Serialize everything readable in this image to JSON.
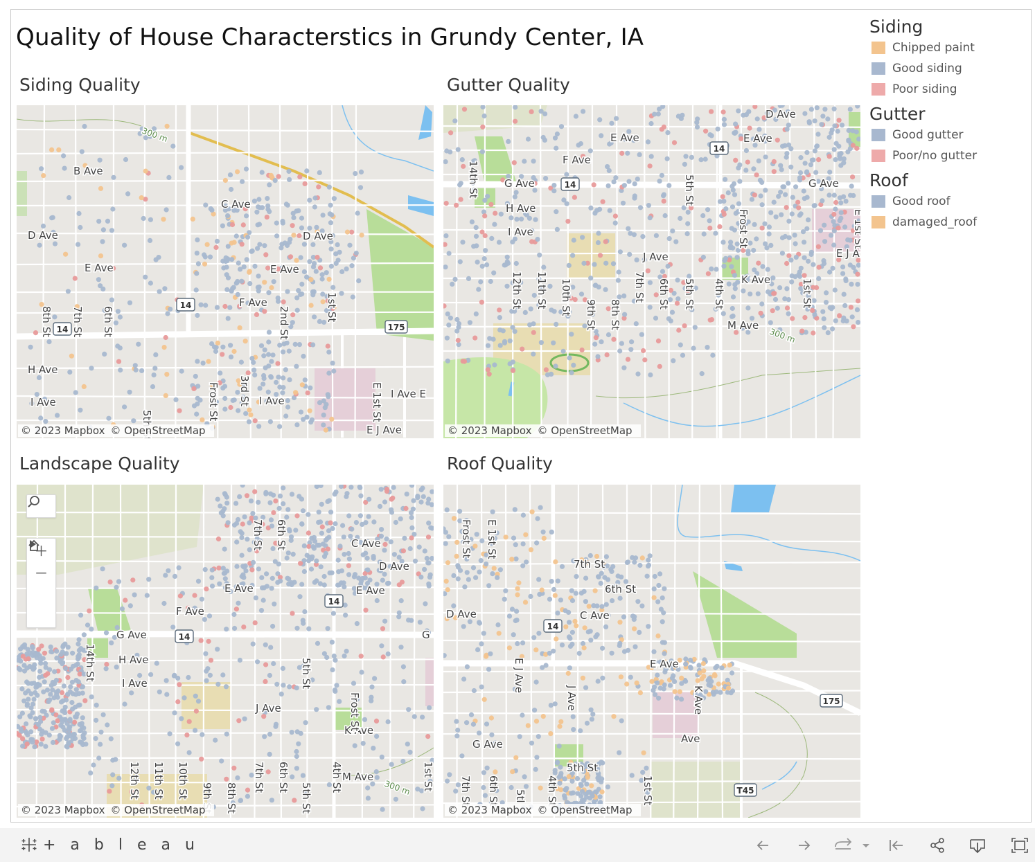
{
  "dashboard": {
    "title": "Quality of House Characterstics in Grundy Center, IA"
  },
  "panels": [
    {
      "title": "Siding Quality",
      "palette": [
        "#a8b8cf",
        "#a8b8cf",
        "#a8b8cf",
        "#a8b8cf",
        "#a8b8cf",
        "#a8b8cf",
        "#e89a9a",
        "#f3c48e"
      ],
      "labels": [
        "B Ave",
        "C Ave",
        "D Ave",
        "D Ave",
        "E Ave",
        "E Ave",
        "F Ave",
        "H Ave",
        "I Ave",
        "I Ave",
        "I Ave E",
        "E J Ave",
        "8th St",
        "7th St",
        "6th St",
        "5th St",
        "Frost St",
        "3rd St",
        "2nd St",
        "1st St",
        "E 1st St",
        "300 m"
      ],
      "shields": [
        "14",
        "14",
        "175"
      ]
    },
    {
      "title": "Gutter Quality",
      "palette": [
        "#a8b8cf",
        "#a8b8cf",
        "#a8b8cf",
        "#a8b8cf",
        "#e89a9a"
      ],
      "labels": [
        "D Ave",
        "E Ave",
        "E Ave",
        "F Ave",
        "G Ave",
        "G Ave",
        "H Ave",
        "I Ave",
        "J Ave",
        "K Ave",
        "M Ave",
        "E J A",
        "14th St",
        "12th St",
        "11th St",
        "10th St",
        "9th St",
        "8th St",
        "7th St",
        "6th St",
        "5th St",
        "5th St",
        "Frost St",
        "4th St",
        "1st St",
        "E 1st St",
        "300 m"
      ],
      "shields": [
        "14",
        "14"
      ]
    },
    {
      "title": "Landscape Quality",
      "palette": [
        "#a8b8cf",
        "#a8b8cf",
        "#a8b8cf",
        "#a8b8cf",
        "#a8b8cf",
        "#e89a9a"
      ],
      "labels": [
        "C Ave",
        "D Ave",
        "E Ave",
        "E Ave",
        "F Ave",
        "G Ave",
        "G",
        "H Ave",
        "I Ave",
        "J Ave",
        "K Ave",
        "M Ave",
        "7th St",
        "6th St",
        "14th St",
        "12th St",
        "11th St",
        "10th St",
        "9th St",
        "8th St",
        "7th St",
        "6th St",
        "5th St",
        "5th St",
        "Frost St",
        "4th St",
        "1st St",
        "300 m"
      ],
      "shields": [
        "14",
        "14"
      ]
    },
    {
      "title": "Roof Quality",
      "palette": [
        "#a8b8cf",
        "#a8b8cf",
        "#a8b8cf",
        "#f3c48e"
      ],
      "labels": [
        "7th St",
        "6th St",
        "C Ave",
        "D Ave",
        "E Ave",
        "Ave",
        "G Ave",
        "5th St",
        "Frost St",
        "E 1st St",
        "E J Ave",
        "J Ave",
        "K Ave",
        "7th St",
        "6th St",
        "5tl",
        "4th St",
        "1st St"
      ],
      "shields": [
        "14",
        "175",
        "T45"
      ]
    }
  ],
  "attribution": [
    "© 2023 Mapbox",
    "© OpenStreetMap"
  ],
  "map_controls": [
    "search-icon",
    "zoom-in-icon",
    "zoom-out-icon",
    "home-icon",
    "play-icon"
  ],
  "legend": {
    "groups": [
      {
        "title": "Siding",
        "items": [
          {
            "label": "Chipped paint",
            "color": "#f3c48e"
          },
          {
            "label": "Good siding",
            "color": "#a8b8cf"
          },
          {
            "label": "Poor siding",
            "color": "#eeaaaa"
          }
        ]
      },
      {
        "title": "Gutter",
        "items": [
          {
            "label": "Good gutter",
            "color": "#a8b8cf"
          },
          {
            "label": "Poor/no gutter",
            "color": "#eeaaaa"
          }
        ]
      },
      {
        "title": "Roof",
        "items": [
          {
            "label": "Good roof",
            "color": "#a8b8cf"
          },
          {
            "label": "damaged_roof",
            "color": "#f3c48e"
          }
        ]
      }
    ]
  },
  "toolbar": {
    "logo_text": "+ a b l e a u",
    "buttons": [
      "undo-icon",
      "redo-icon",
      "revert-icon",
      "revert-menu-icon",
      "reset-icon",
      "share-icon",
      "download-icon",
      "fullscreen-icon"
    ]
  }
}
